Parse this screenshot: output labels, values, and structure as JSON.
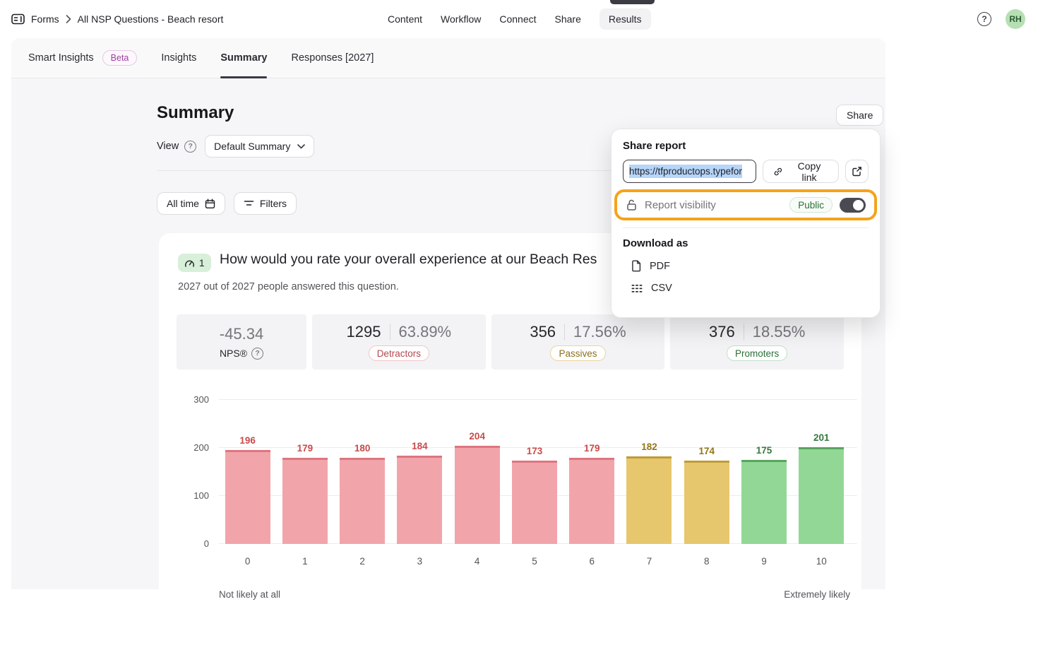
{
  "colors": {
    "accent_orange": "#f5a31b",
    "toggle_on": "#4a4a52",
    "selection_blue": "#b5d5f9",
    "avatar_green": "#b6dfb3",
    "question_badge_green": "#d8efd9",
    "active_tab_indicator": "#3b3b44"
  },
  "topnav": {
    "breadcrumb": {
      "app": "Forms",
      "title": "All NSP Questions - Beach resort"
    },
    "tabs": [
      {
        "label": "Content"
      },
      {
        "label": "Workflow"
      },
      {
        "label": "Connect"
      },
      {
        "label": "Share"
      },
      {
        "label": "Results",
        "active": true
      }
    ],
    "avatar_initials": "RH"
  },
  "tabbar": {
    "items": [
      {
        "label": "Smart Insights",
        "badge": "Beta"
      },
      {
        "label": "Insights"
      },
      {
        "label": "Summary",
        "active": true
      },
      {
        "label": "Responses [2027]"
      }
    ]
  },
  "page": {
    "title": "Summary",
    "view_label": "View",
    "view_value": "Default Summary",
    "share_button": "Share",
    "time_filter": "All time",
    "filters": "Filters"
  },
  "share_popup": {
    "title": "Share report",
    "url": "https://tfproductops.typefor",
    "copy_link": "Copy link",
    "visibility_label": "Report visibility",
    "visibility_value": "Public",
    "toggle_state": "on",
    "download_label": "Download as",
    "download_options": [
      {
        "label": "PDF",
        "icon": "file-icon"
      },
      {
        "label": "CSV",
        "icon": "table-icon"
      }
    ]
  },
  "question": {
    "index": "1",
    "title": "How would you rate your overall experience at our Beach Res",
    "answered": "2027 out of 2027 people answered this question."
  },
  "stats": {
    "nps": {
      "value": "-45.34",
      "label": "NPS®"
    },
    "groups": [
      {
        "count": "1295",
        "percent": "63.89%",
        "label": "Detractors",
        "text_color": "#b24a50",
        "border_color": "#efc6c9"
      },
      {
        "count": "356",
        "percent": "17.56%",
        "label": "Passives",
        "text_color": "#8a701f",
        "border_color": "#e9d59d"
      },
      {
        "count": "376",
        "percent": "18.55%",
        "label": "Promoters",
        "text_color": "#2c6e38",
        "border_color": "#c2e0c7"
      }
    ]
  },
  "chart_data": {
    "type": "bar",
    "title": "",
    "categories": [
      "0",
      "1",
      "2",
      "3",
      "4",
      "5",
      "6",
      "7",
      "8",
      "9",
      "10"
    ],
    "values": [
      196,
      179,
      180,
      184,
      204,
      173,
      179,
      182,
      174,
      175,
      201
    ],
    "segments": [
      "detractor",
      "detractor",
      "detractor",
      "detractor",
      "detractor",
      "detractor",
      "detractor",
      "passive",
      "passive",
      "promoter",
      "promoter"
    ],
    "yticks": [
      0,
      100,
      200,
      300
    ],
    "ylim": [
      0,
      300
    ],
    "grid": true,
    "x_caption_left": "Not likely at all",
    "x_caption_right": "Extremely likely",
    "colors": {
      "detractor": {
        "fill": "#f2a4ab",
        "top": "#dd7680",
        "label": "#c94b4b"
      },
      "passive": {
        "fill": "#e7c76d",
        "top": "#c09c38",
        "label": "#93761a"
      },
      "promoter": {
        "fill": "#93d797",
        "top": "#58a55e",
        "label": "#337a3b"
      }
    }
  }
}
